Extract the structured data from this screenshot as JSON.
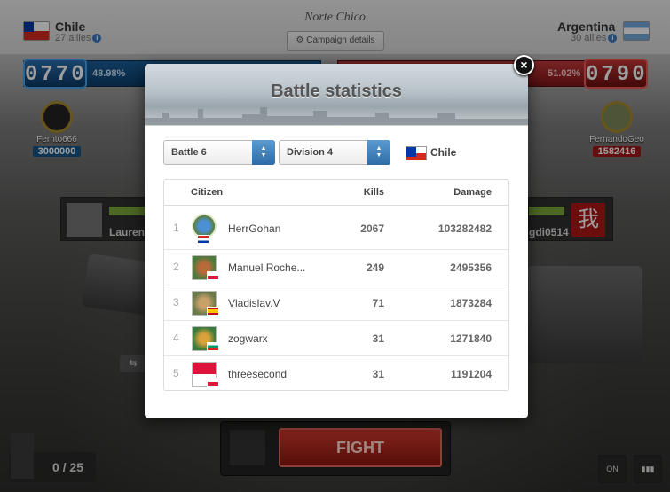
{
  "header": {
    "region": "Norte Chico",
    "campaign_button": "Campaign details",
    "left": {
      "country": "Chile",
      "allies": "27 allies",
      "score": "0770",
      "percent": "48.98%"
    },
    "right": {
      "country": "Argentina",
      "allies": "30 allies",
      "score": "0790",
      "percent": "51.02%"
    }
  },
  "heroes": {
    "left": {
      "name": "Fernto666",
      "damage": "3000000"
    },
    "right": {
      "name": "FernandoGeo",
      "damage": "1582416"
    }
  },
  "side_panels": {
    "left_name": "Lauren",
    "right_name": "gdi0514"
  },
  "bottom": {
    "fight_label": "FIGHT",
    "ammo": "0 / 25",
    "toggle_label": "ON"
  },
  "modal": {
    "title": "Battle statistics",
    "close_label": "×",
    "battle_select": "Battle 6",
    "division_select": "Division 4",
    "country_filter": "Chile",
    "columns": {
      "citizen": "Citizen",
      "kills": "Kills",
      "damage": "Damage"
    },
    "rows": [
      {
        "rank": "1",
        "name": "HerrGohan",
        "kills": "2067",
        "damage": "103282482",
        "flag": "croatia"
      },
      {
        "rank": "2",
        "name": "Manuel Roche...",
        "kills": "249",
        "damage": "2495356",
        "flag": "poland"
      },
      {
        "rank": "3",
        "name": "Vladislav.V",
        "kills": "71",
        "damage": "1873284",
        "flag": "spain"
      },
      {
        "rank": "4",
        "name": "zogwarx",
        "kills": "31",
        "damage": "1271840",
        "flag": "bulgaria"
      },
      {
        "rank": "5",
        "name": "threesecond",
        "kills": "31",
        "damage": "1191204",
        "flag": "poland"
      }
    ]
  },
  "colors": {
    "left_team": "#1a5f9a",
    "right_team": "#c23a3a",
    "fight": "#d33a2f",
    "select_arrow": "#2d6ca6"
  }
}
